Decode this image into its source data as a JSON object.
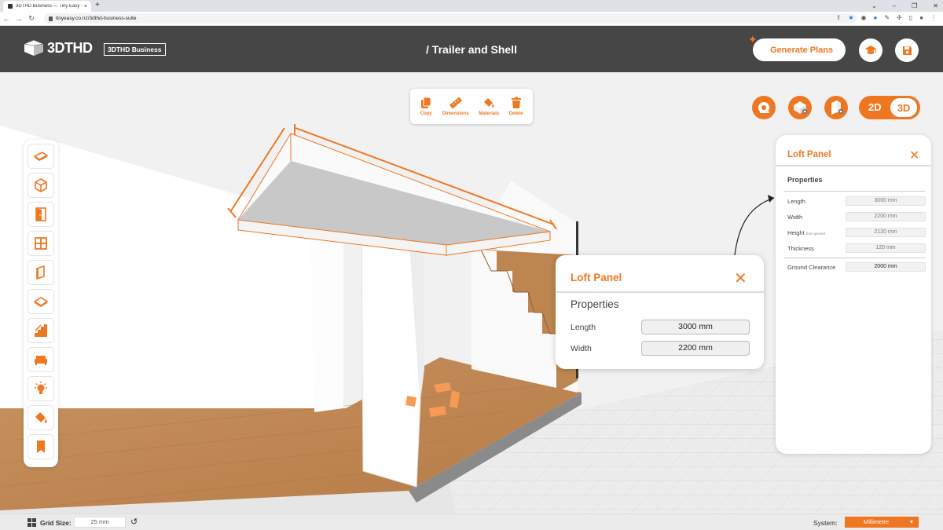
{
  "browser": {
    "tab_title": "3DTHD Business — Tiny Easy - T",
    "tab_close": "×",
    "new_tab": "+",
    "url": "tinyeasy.co.nz/3dthd-business-suite",
    "nav": {
      "back": "←",
      "forward": "→",
      "reload": "↻"
    },
    "window_controls": {
      "dropdown": "⌄",
      "minimize": "–",
      "restore": "❐",
      "close": "✕"
    }
  },
  "header": {
    "logo_text": "3DTHD",
    "badge": "3DTHD Business",
    "title": "/ Trailer and Shell",
    "generate_label": "Generate Plans"
  },
  "toolbar": {
    "copy": "Copy",
    "dimensions": "Dimensions",
    "materials": "Materials",
    "delete": "Delete"
  },
  "view_toggle": {
    "two_d": "2D",
    "three_d": "3D"
  },
  "right_panel": {
    "title": "Loft Panel",
    "close": "✕",
    "section": "Properties",
    "length_label": "Length",
    "length_value": "3000 mm",
    "width_label": "Width",
    "width_value": "2200 mm",
    "height_label": "Height",
    "height_note": "from ground",
    "height_value": "2120 mm",
    "thickness_label": "Thickness",
    "thickness_value": "120 mm",
    "clearance_label": "Ground Clearance",
    "clearance_value": "2000 mm"
  },
  "float_panel": {
    "title": "Loft Panel",
    "close": "✕",
    "section": "Properties",
    "length_label": "Length",
    "length_value": "3000 mm",
    "width_label": "Width",
    "width_value": "2200 mm"
  },
  "statusbar": {
    "grid_label": "Grid Size:",
    "grid_value": "25 mm",
    "reset": "↺",
    "system_label": "System:",
    "system_value": "Millimetre",
    "system_arrow": "▾"
  },
  "colors": {
    "accent": "#f07722",
    "header_bg": "#464646",
    "wood": "#c68f5d"
  }
}
